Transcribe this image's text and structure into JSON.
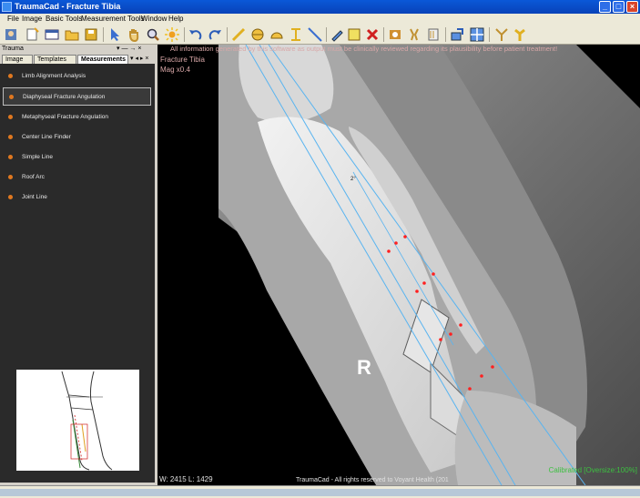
{
  "window": {
    "title": "TraumaCad - Fracture Tibia"
  },
  "menu": [
    "File",
    "Image",
    "Basic Tools",
    "Measurement Tools",
    "Window",
    "Help"
  ],
  "panel": {
    "title": "Trauma",
    "controls": "▾ ― → ×",
    "tabs": [
      "Image",
      "Templates",
      "Measurements"
    ],
    "active_tab": "Measurements",
    "tab_controls": "▾ ◂ ▸ ×",
    "items": [
      {
        "label": "Limb Alignment Analysis"
      },
      {
        "label": "Diaphyseal Fracture Angulation"
      },
      {
        "label": "Metaphyseal Fracture Angulation"
      },
      {
        "label": "Center Line Finder"
      },
      {
        "label": "Simple Line"
      },
      {
        "label": "Roof Arc"
      },
      {
        "label": "Joint Line"
      }
    ]
  },
  "viewer": {
    "notice": "All information generated by this software as output must be clinically reviewed regarding its plausibility before patient treatment!",
    "study_title": "Fracture Tibia",
    "magnification": "Mag x0.4",
    "side_marker": "R",
    "angle_label": "2°",
    "calibration": "Calibrated [Oversize:100%]",
    "window_level": "W:  2415 L:  1429",
    "copyright": "TraumaCad -  All rights reserved to Voyant Health  (201",
    "colors": {
      "measure_line": "#59b4f0",
      "points": "#ff2020",
      "calibration": "#3cc040"
    }
  }
}
